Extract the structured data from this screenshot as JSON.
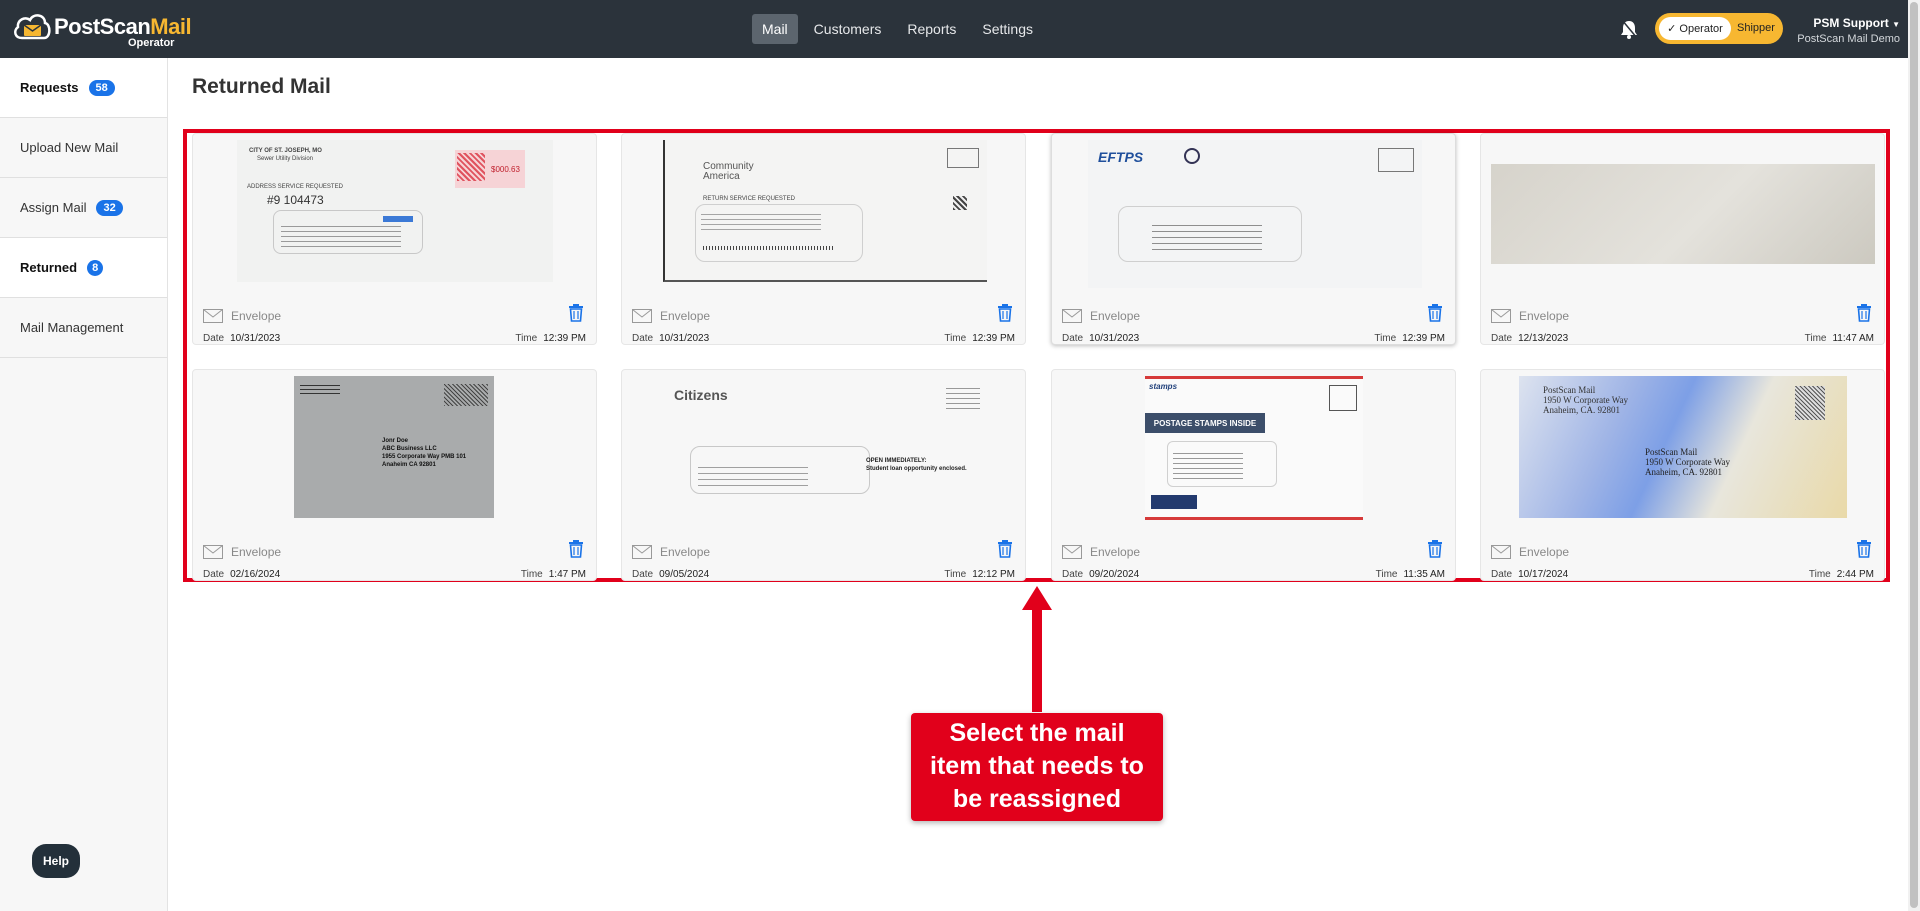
{
  "header": {
    "brand_part1": "PostScan",
    "brand_part2": "Mail",
    "subtitle": "Operator",
    "nav": [
      {
        "label": "Mail",
        "active": true
      },
      {
        "label": "Customers",
        "active": false
      },
      {
        "label": "Reports",
        "active": false
      },
      {
        "label": "Settings",
        "active": false
      }
    ],
    "role_toggle": {
      "selected": "Operator",
      "other": "Shipper"
    },
    "user_name": "PSM Support",
    "user_org": "PostScan Mail Demo"
  },
  "sidebar": {
    "items": [
      {
        "label": "Requests",
        "badge": "58"
      },
      {
        "label": "Upload New Mail",
        "badge": ""
      },
      {
        "label": "Assign Mail",
        "badge": "32"
      },
      {
        "label": "Returned",
        "badge": "8"
      },
      {
        "label": "Mail Management",
        "badge": ""
      }
    ],
    "help_label": "Help"
  },
  "main": {
    "title": "Returned Mail",
    "date_label": "Date",
    "time_label": "Time",
    "cards": [
      {
        "type": "Envelope",
        "date": "10/31/2023",
        "time": "12:39 PM"
      },
      {
        "type": "Envelope",
        "date": "10/31/2023",
        "time": "12:39 PM"
      },
      {
        "type": "Envelope",
        "date": "10/31/2023",
        "time": "12:39 PM"
      },
      {
        "type": "Envelope",
        "date": "12/13/2023",
        "time": "11:47 AM"
      },
      {
        "type": "Envelope",
        "date": "02/16/2024",
        "time": "1:47 PM"
      },
      {
        "type": "Envelope",
        "date": "09/05/2024",
        "time": "12:12 PM"
      },
      {
        "type": "Envelope",
        "date": "09/20/2024",
        "time": "11:35 AM"
      },
      {
        "type": "Envelope",
        "date": "10/17/2024",
        "time": "2:44 PM"
      }
    ],
    "envelopes": {
      "e1_city": "CITY OF ST. JOSEPH, MO",
      "e1_div": "Sewer Utility Division",
      "e1_service": "ADDRESS SERVICE REQUESTED",
      "e1_hand": "#9 104473",
      "e1_postage": "$000.63",
      "e2_sender": "Community America",
      "e2_service": "RETURN SERVICE REQUESTED",
      "e3_sender": "EFTPS",
      "e5_addr1": "Jonr Doe",
      "e5_addr2": "ABC Business LLC",
      "e5_addr3": "1955 Corporate Way PMB 101",
      "e5_addr4": "Anaheim CA 92801",
      "e6_sender": "Citizens",
      "e6_note1": "OPEN IMMEDIATELY:",
      "e6_note2": "Student loan opportunity enclosed.",
      "e7_banner": "POSTAGE STAMPS INSIDE",
      "e7_logo": "stamps",
      "e8_from1": "PostScan Mail",
      "e8_from2": "1950 W Corporate Way",
      "e8_from3": "Anaheim, CA. 92801",
      "e8_to1": "PostScan Mail",
      "e8_to2": "1950 W Corporate Way",
      "e8_to3": "Anaheim, CA. 92801"
    }
  },
  "annotation": {
    "line1": "Select the mail",
    "line2": "item that needs to",
    "line3": "be reassigned"
  },
  "colors": {
    "topbar": "#2b333b",
    "accent_yellow": "#f7b731",
    "badge_blue": "#1a73e8",
    "annotation_red": "#e1001b"
  }
}
